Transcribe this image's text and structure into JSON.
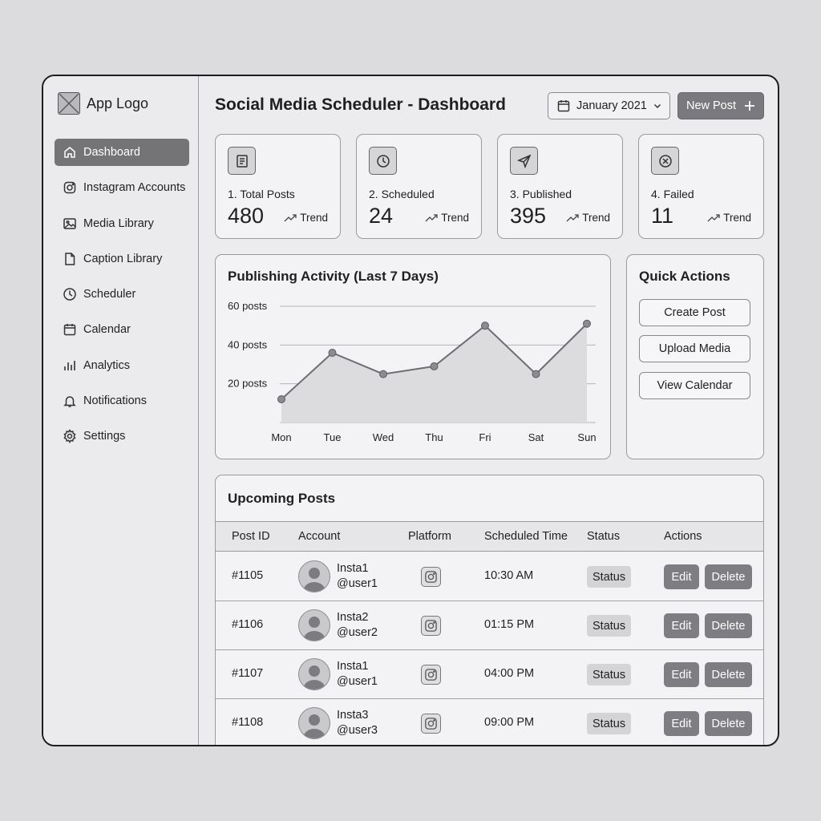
{
  "app": {
    "logo_text": "App Logo"
  },
  "sidebar": {
    "items": [
      {
        "label": "Dashboard",
        "icon": "home-icon",
        "active": true
      },
      {
        "label": "Instagram Accounts",
        "icon": "instagram-icon"
      },
      {
        "label": "Media Library",
        "icon": "image-icon"
      },
      {
        "label": "Caption Library",
        "icon": "document-icon"
      },
      {
        "label": "Scheduler",
        "icon": "clock-icon"
      },
      {
        "label": "Calendar",
        "icon": "calendar-icon"
      },
      {
        "label": "Analytics",
        "icon": "bar-chart-icon"
      },
      {
        "label": "Notifications",
        "icon": "bell-icon"
      },
      {
        "label": "Settings",
        "icon": "gear-icon"
      }
    ]
  },
  "header": {
    "title": "Social Media Scheduler - Dashboard",
    "date_selector": "January 2021",
    "new_post_label": "New Post"
  },
  "stats": [
    {
      "label": "1. Total Posts",
      "value": "480",
      "trend": "Trend",
      "icon": "document-icon"
    },
    {
      "label": "2. Scheduled",
      "value": "24",
      "trend": "Trend",
      "icon": "clock-icon"
    },
    {
      "label": "3. Published",
      "value": "395",
      "trend": "Trend",
      "icon": "send-icon"
    },
    {
      "label": "4. Failed",
      "value": "11",
      "trend": "Trend",
      "icon": "x-circle-icon"
    }
  ],
  "chart_data": {
    "type": "area",
    "title": "Publishing Activity (Last 7 Days)",
    "categories": [
      "Mon",
      "Tue",
      "Wed",
      "Thu",
      "Fri",
      "Sat",
      "Sun"
    ],
    "values": [
      12,
      36,
      25,
      29,
      50,
      25,
      51
    ],
    "y_ticks": [
      20,
      40,
      60
    ],
    "y_tick_labels": [
      "20 posts",
      "40 posts",
      "60 posts"
    ],
    "ylim": [
      0,
      60
    ],
    "grid": true
  },
  "quick_actions": {
    "title": "Quick Actions",
    "buttons": [
      "Create Post",
      "Upload Media",
      "View Calendar"
    ]
  },
  "upcoming": {
    "title": "Upcoming Posts",
    "columns": [
      "Post ID",
      "Account",
      "Platform",
      "Scheduled Time",
      "Status",
      "Actions"
    ],
    "rows": [
      {
        "id": "#1105",
        "name": "Insta1",
        "handle": "@user1",
        "time": "10:30 AM",
        "status": "Status",
        "edit": "Edit",
        "delete": "Delete"
      },
      {
        "id": "#1106",
        "name": "Insta2",
        "handle": "@user2",
        "time": "01:15 PM",
        "status": "Status",
        "edit": "Edit",
        "delete": "Delete"
      },
      {
        "id": "#1107",
        "name": "Insta1",
        "handle": "@user1",
        "time": "04:00 PM",
        "status": "Status",
        "edit": "Edit",
        "delete": "Delete"
      },
      {
        "id": "#1108",
        "name": "Insta3",
        "handle": "@user3",
        "time": "09:00 PM",
        "status": "Status",
        "edit": "Edit",
        "delete": "Delete"
      }
    ]
  }
}
